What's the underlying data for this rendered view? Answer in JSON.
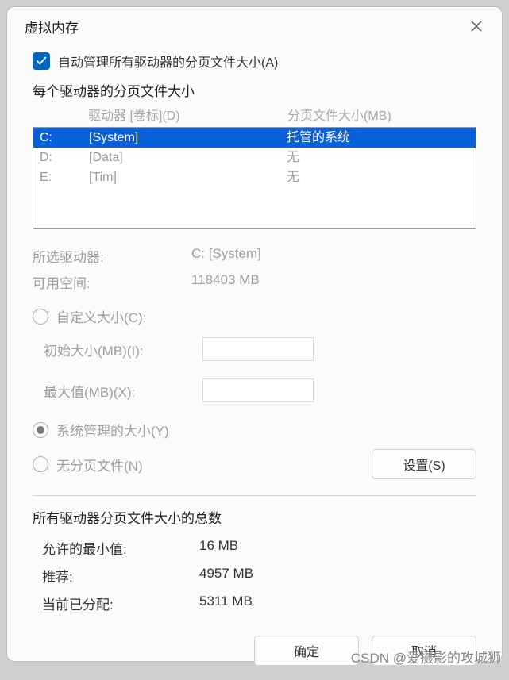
{
  "window": {
    "title": "虚拟内存"
  },
  "autoManage": {
    "label": "自动管理所有驱动器的分页文件大小(A)",
    "checked": true
  },
  "perDrive": {
    "title": "每个驱动器的分页文件大小",
    "headers": {
      "drive": "驱动器 [卷标](D)",
      "size": "分页文件大小(MB)"
    },
    "rows": [
      {
        "drive": "C:",
        "label": "[System]",
        "size": "托管的系统",
        "selected": true
      },
      {
        "drive": "D:",
        "label": "[Data]",
        "size": "无",
        "selected": false
      },
      {
        "drive": "E:",
        "label": "[Tim]",
        "size": "无",
        "selected": false
      }
    ]
  },
  "selected": {
    "driveLabel": "所选驱动器:",
    "driveValue": "C:  [System]",
    "freeLabel": "可用空间:",
    "freeValue": "118403 MB"
  },
  "options": {
    "custom": {
      "label": "自定义大小(C):"
    },
    "initialLabel": "初始大小(MB)(I):",
    "initialValue": "",
    "maxLabel": "最大值(MB)(X):",
    "maxValue": "",
    "system": {
      "label": "系统管理的大小(Y)",
      "selected": true
    },
    "none": {
      "label": "无分页文件(N)"
    },
    "setBtn": "设置(S)"
  },
  "totals": {
    "title": "所有驱动器分页文件大小的总数",
    "minLabel": "允许的最小值:",
    "minValue": "16 MB",
    "recLabel": "推荐:",
    "recValue": "4957 MB",
    "curLabel": "当前已分配:",
    "curValue": "5311 MB"
  },
  "buttons": {
    "ok": "确定",
    "cancel": "取消"
  },
  "watermark": "CSDN @爱摄影的攻城狮"
}
